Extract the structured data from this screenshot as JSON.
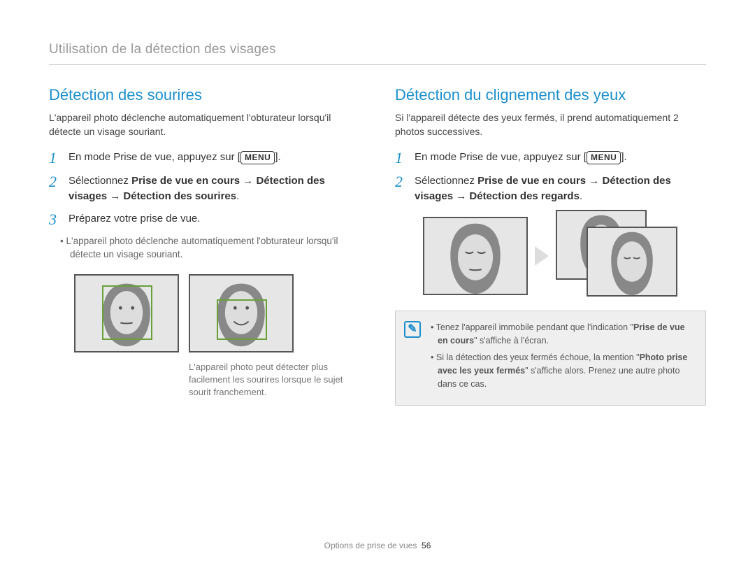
{
  "header": "Utilisation de la détection des visages",
  "footer": {
    "section": "Options de prise de vues",
    "page": "56"
  },
  "menu_label": "MENU",
  "left": {
    "title": "Détection des sourires",
    "intro": "L'appareil photo déclenche automatiquement l'obturateur lorsqu'il détecte un visage souriant.",
    "step1_pre": "En mode Prise de vue, appuyez sur [",
    "step1_post": "].",
    "step2a": "Sélectionnez ",
    "step2b": "Prise de vue en cours",
    "step2c": " → ",
    "step2d": "Détection des visages",
    "step2e": " → ",
    "step2f": "Détection des sourires",
    "step2g": ".",
    "step3": "Préparez votre prise de vue.",
    "step3_sub": "L'appareil photo déclenche automatiquement l'obturateur lorsqu'il détecte un visage souriant.",
    "caption": "L'appareil photo peut détecter plus facilement les sourires lorsque le sujet sourit franchement."
  },
  "right": {
    "title": "Détection du clignement des yeux",
    "intro": "Si l'appareil détecte des yeux fermés, il prend automatiquement 2 photos successives.",
    "step1_pre": "En mode Prise de vue, appuyez sur [",
    "step1_post": "].",
    "step2a": "Sélectionnez ",
    "step2b": "Prise de vue en cours",
    "step2c": " → ",
    "step2d": "Détection des visages",
    "step2e": " → ",
    "step2f": "Détection des regards",
    "step2g": ".",
    "note1a": "Tenez l'appareil immobile pendant que l'indication \"",
    "note1b": "Prise de vue en cours",
    "note1c": "\" s'affiche à l'écran.",
    "note2a": "Si la détection des yeux fermés échoue, la mention \"",
    "note2b": "Photo prise avec les yeux fermés",
    "note2c": "\" s'affiche alors. Prenez une autre photo dans ce cas."
  }
}
